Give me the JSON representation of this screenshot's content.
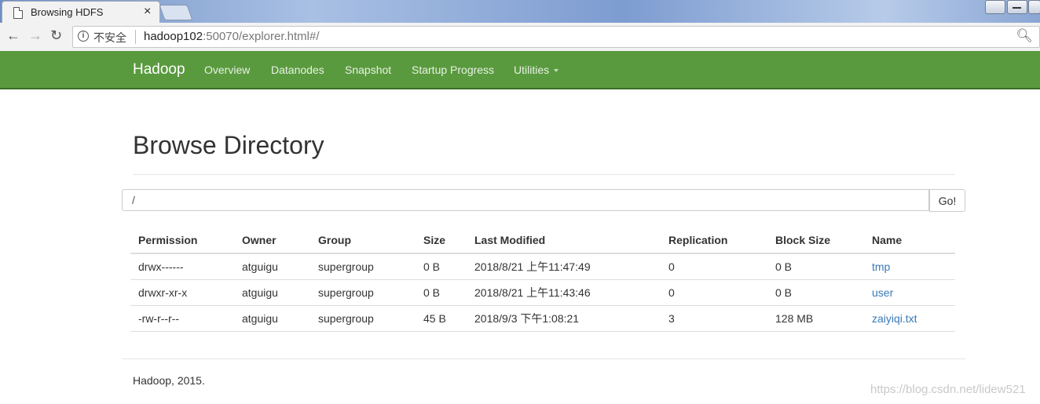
{
  "browser": {
    "tab_title": "Browsing HDFS",
    "tab_close": "×",
    "insecure_label": "不安全",
    "url_host": "hadoop102",
    "url_rest": ":50070/explorer.html#/"
  },
  "navbar": {
    "brand": "Hadoop",
    "links": [
      "Overview",
      "Datanodes",
      "Snapshot",
      "Startup Progress",
      "Utilities"
    ]
  },
  "main": {
    "title": "Browse Directory",
    "path_value": "/",
    "go_label": "Go!",
    "columns": [
      "Permission",
      "Owner",
      "Group",
      "Size",
      "Last Modified",
      "Replication",
      "Block Size",
      "Name"
    ],
    "rows": [
      [
        "drwx------",
        "atguigu",
        "supergroup",
        "0 B",
        "2018/8/21 上午11:47:49",
        "0",
        "0 B",
        "tmp"
      ],
      [
        "drwxr-xr-x",
        "atguigu",
        "supergroup",
        "0 B",
        "2018/8/21 上午11:43:46",
        "0",
        "0 B",
        "user"
      ],
      [
        "-rw-r--r--",
        "atguigu",
        "supergroup",
        "45 B",
        "2018/9/3 下午1:08:21",
        "3",
        "128 MB",
        "zaiyiqi.txt"
      ]
    ]
  },
  "footer": {
    "text": "Hadoop, 2015."
  },
  "watermark": "https://blog.csdn.net/lidew521",
  "colors": {
    "navbar": "#5a9a3f",
    "link": "#3a78b5"
  }
}
